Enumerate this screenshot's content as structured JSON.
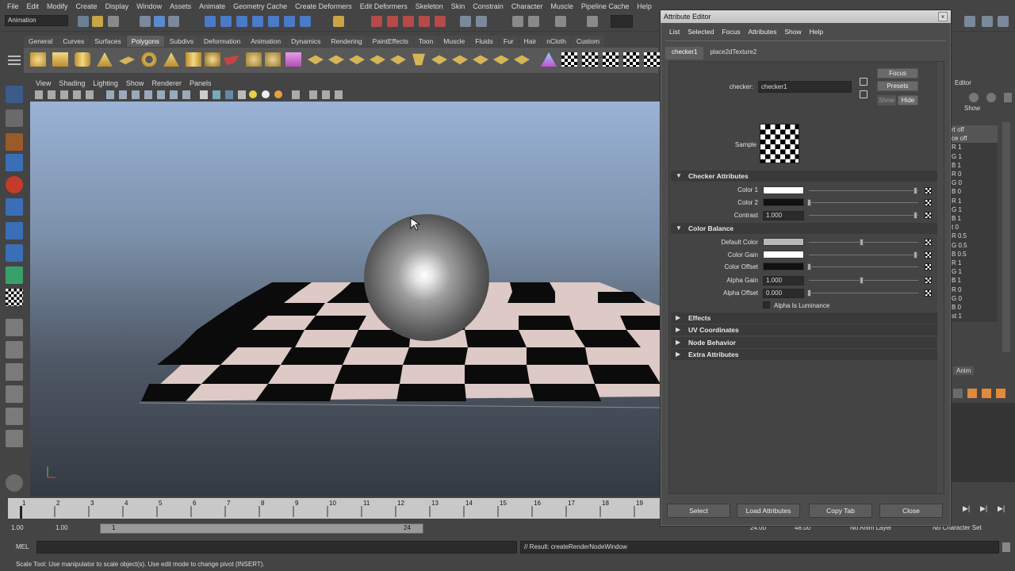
{
  "menubar": [
    "File",
    "Edit",
    "Modify",
    "Create",
    "Display",
    "Window",
    "Assets",
    "Animate",
    "Geometry Cache",
    "Create Deformers",
    "Edit Deformers",
    "Skeleton",
    "Skin",
    "Constrain",
    "Character",
    "Muscle",
    "Pipeline Cache",
    "Help"
  ],
  "statusline": {
    "mode": "Animation"
  },
  "shelf_tabs": [
    "General",
    "Curves",
    "Surfaces",
    "Polygons",
    "Subdivs",
    "Deformation",
    "Animation",
    "Dynamics",
    "Rendering",
    "PaintEffects",
    "Toon",
    "Muscle",
    "Fluids",
    "Fur",
    "Hair",
    "nCloth",
    "Custom"
  ],
  "shelf_active": "Polygons",
  "viewport_menu": [
    "View",
    "Shading",
    "Lighting",
    "Show",
    "Renderer",
    "Panels"
  ],
  "timeline": {
    "ticks": [
      "1",
      "2",
      "3",
      "4",
      "5",
      "6",
      "7",
      "8",
      "9",
      "10",
      "11",
      "12",
      "13",
      "14",
      "15",
      "16",
      "17",
      "18",
      "19"
    ]
  },
  "range": {
    "start": "1.00",
    "start2": "1.00",
    "range_start": "1",
    "range_end": "24",
    "end1": "24.00",
    "end2": "48.00",
    "anim_layer": "No Anim Layer",
    "char_set": "No Character Set"
  },
  "cmdline": {
    "label": "MEL",
    "result": "// Result: createRenderNodeWindow"
  },
  "helpline": "Scale Tool: Use manipulator to scale object(s). Use edit mode to change pivot (INSERT).",
  "channelbox": {
    "title": "Editor",
    "show": "Show",
    "anim_tab": "Anim",
    "values": [
      "rt off",
      "ce off",
      "R 1",
      "G 1",
      "B 1",
      "R 0",
      "G 0",
      "B 0",
      "R 1",
      "G 1",
      "B 1",
      "t 0",
      "R 0.5",
      "G 0.5",
      "B 0.5",
      "R 1",
      "G 1",
      "B 1",
      "R 0",
      "G 0",
      "B 0",
      "st 1"
    ]
  },
  "attribute_editor": {
    "title": "Attribute Editor",
    "close": "×",
    "menu": [
      "List",
      "Selected",
      "Focus",
      "Attributes",
      "Show",
      "Help"
    ],
    "tabs": [
      "checker1",
      "place2dTexture2"
    ],
    "node_label": "checker:",
    "node_name": "checker1",
    "buttons": {
      "focus": "Focus",
      "presets": "Presets",
      "show": "Show",
      "hide": "Hide"
    },
    "sample_label": "Sample",
    "sections": {
      "checker_attributes": "Checker Attributes",
      "color_balance": "Color Balance",
      "effects": "Effects",
      "uv_coordinates": "UV Coordinates",
      "node_behavior": "Node Behavior",
      "extra_attributes": "Extra Attributes"
    },
    "checker_attrs": {
      "color1_label": "Color 1",
      "color2_label": "Color 2",
      "contrast_label": "Contrast",
      "contrast_value": "1.000"
    },
    "color_balance": {
      "default_color_label": "Default Color",
      "color_gain_label": "Color Gain",
      "color_offset_label": "Color Offset",
      "alpha_gain_label": "Alpha Gain",
      "alpha_gain_value": "1.000",
      "alpha_offset_label": "Alpha Offset",
      "alpha_offset_value": "0.000",
      "alpha_is_luminance": "Alpha Is Luminance"
    },
    "footer": [
      "Select",
      "Load Attributes",
      "Copy Tab",
      "Close"
    ]
  },
  "colors": {
    "color1": "#ffffff",
    "color2": "#111111",
    "default_color": "#b8b8b8",
    "color_gain": "#ffffff",
    "color_offset": "#111111"
  }
}
